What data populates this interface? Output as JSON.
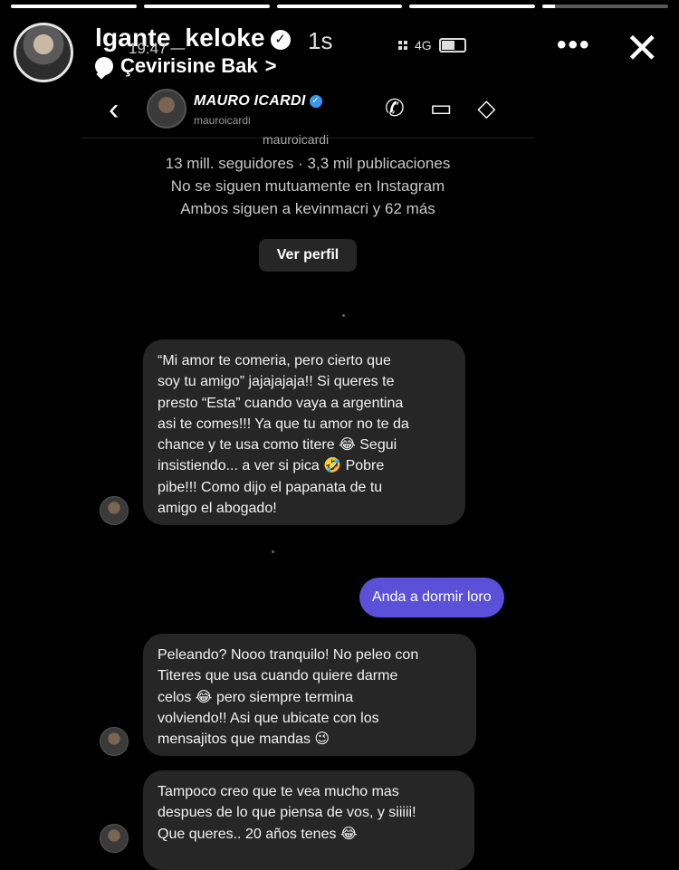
{
  "story": {
    "progress": [
      1,
      1,
      1,
      1,
      0.1
    ],
    "username": "lgante_keloke",
    "verified_glyph": "✓",
    "time": "1s",
    "embedded_clock": "19:47",
    "network": "4G",
    "translate_label": "Çevirisine Bak",
    "translate_chevron": ">",
    "more_glyph": "•••",
    "close_glyph": "✕"
  },
  "dm": {
    "back_glyph": "‹",
    "contact_name": "MAURO ICARDI",
    "verified_glyph": "✓",
    "contact_handle": "mauroicardi",
    "actions": [
      {
        "icon": "phone-icon",
        "glyph": "✆"
      },
      {
        "icon": "video-icon",
        "glyph": "▭"
      },
      {
        "icon": "tag-icon",
        "glyph": "◇"
      }
    ],
    "profile_handle_cut": "mauroicardi",
    "profile_lines": [
      "13 mill. seguidores · 3,3 mil publicaciones",
      "No se siguen mutuamente en Instagram",
      "Ambos siguen a kevinmacri y 62 más"
    ],
    "view_profile_label": "Ver perfil"
  },
  "messages": [
    {
      "from": "them",
      "text": "“Mi amor te comeria, pero cierto que\nsoy tu amigo” jajajajaja!! Si queres te\npresto “Esta” cuando vaya a argentina\nasi te comes!!! Ya que tu amor no te da\nchance y te usa como titere 😂 Segui\ninsistiendo... a ver si pica 🤣 Pobre\npibe!!! Como dijo el papanata de tu\namigo el abogado!"
    },
    {
      "from": "me",
      "text": "Anda a dormir loro"
    },
    {
      "from": "them",
      "text": "Peleando? Nooo tranquilo! No peleo con\nTiteres que usa cuando quiere darme\ncelos 😂 pero siempre termina\nvolviendo!! Asi que ubicate con los\nmensajitos que mandas 😉"
    },
    {
      "from": "them",
      "text": "Tampoco creo que te vea mucho mas\ndespues de lo que piensa de vos, y siiiii!\nQue queres.. 20 años tenes 😂"
    }
  ],
  "colors": {
    "background": "#000000",
    "incoming_bubble": "#262626",
    "outgoing_bubble": "#5b51d8",
    "verified_blue": "#3897f0"
  }
}
